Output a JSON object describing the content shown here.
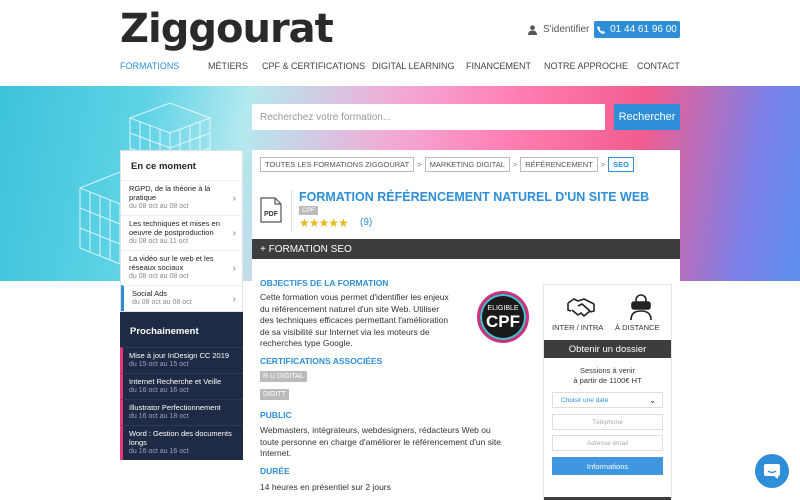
{
  "header": {
    "logo": "Ziggourat",
    "signin_label": "S'identifier",
    "phone": "01 44 61 96 00",
    "nav": [
      "FORMATIONS",
      "MÉTIERS",
      "CPF & CERTIFICATIONS",
      "DIGITAL LEARNING",
      "FINANCEMENT",
      "NOTRE APPROCHE",
      "CONTACT"
    ]
  },
  "search": {
    "placeholder": "Recherchez votre formation...",
    "button": "Rechercher"
  },
  "sidebar": {
    "title": "En ce moment",
    "items": [
      {
        "title": "RGPD, de la théorie à la pratique",
        "dates": "du 08 oct au 08 oct"
      },
      {
        "title": "Les techniques et mises en oeuvre de postproduction",
        "dates": "du 08 oct au 11 oct"
      },
      {
        "title": "La vidéo sur le web et les réseaux sociaux",
        "dates": "du 08 oct au 08 oct"
      },
      {
        "title": "Social Ads",
        "dates": "du 08 oct au 08 oct"
      }
    ],
    "next_title": "Prochainement",
    "next_items": [
      {
        "title": "Mise à jour InDesign CC 2019",
        "dates": "du 15 oct au 15 oct"
      },
      {
        "title": "Internet Recherche et Veille",
        "dates": "du 16 oct au 16 oct"
      },
      {
        "title": "Illustrator Perfectionnement",
        "dates": "du 16 oct au 18 oct"
      },
      {
        "title": "Word : Gestion des documents longs",
        "dates": "du 16 oct au 16 oct"
      }
    ]
  },
  "breadcrumb": [
    "TOUTES LES FORMATIONS ZIGGOURAT",
    "MARKETING DIGITAL",
    "RÉFÉRENCEMENT",
    "SEO"
  ],
  "formation": {
    "pdf_label": "PDF",
    "title": "FORMATION RÉFÉRENCEMENT NATUREL D'UN SITE WEB",
    "cpf_badge": "CPF",
    "stars": "★★★★★",
    "rating_count": "(9)",
    "bar_label": "+ FORMATION SEO",
    "objectifs_title": "OBJECTIFS DE LA FORMATION",
    "objectifs_lines": [
      "Cette formation vous permet d'identifier les enjeux",
      "du référencement naturel d'un site Web. Utiliser",
      "des techniques efficaces permettant l'amélioration",
      "de sa visibilité sur Internet via les moteurs de",
      "recherches type Google."
    ],
    "cpf_eligible_top": "ELIGIBLE",
    "cpf_eligible_bottom": "CPF",
    "certif_title": "CERTIFICATIONS ASSOCIÉES",
    "certif_tags": [
      "R.U DIGITAL",
      "DIGITT"
    ],
    "public_title": "PUBLIC",
    "public_lines": [
      "Webmasters, intégrateurs, webdesigners, rédacteurs Web ou",
      "toute personne en charge d'améliorer le référencement d'un site",
      "Internet."
    ],
    "duree_title": "DURÉE",
    "duree_text": "14 heures en présentiel sur 2 jours"
  },
  "booking": {
    "inter_label": "INTER / INTRA",
    "distance_label": "À DISTANCE",
    "obtain_label": "Obtenir un dossier",
    "sessions_line1": "Sessions à venir",
    "sessions_line2": "à partir de 1100€ HT",
    "date_select": "Choisir une date",
    "phone_placeholder": "Téléphone",
    "email_placeholder": "Adresse email",
    "info_button": "Informations"
  }
}
